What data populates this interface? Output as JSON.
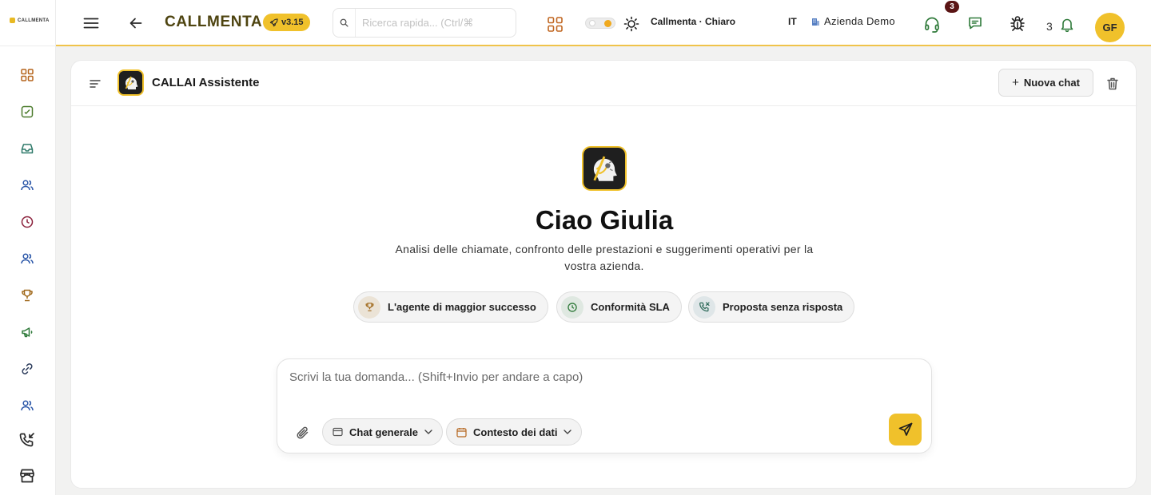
{
  "app": {
    "logo_text": "CALLMENTA",
    "brand": "CALLMENTA",
    "version": "v3.15"
  },
  "sidebar": {
    "items": [
      {
        "name": "dashboard",
        "icon": "grid-icon",
        "color": "#b5651d"
      },
      {
        "name": "reports",
        "icon": "calculator-icon",
        "color": "#4a7a2a"
      },
      {
        "name": "inbox",
        "icon": "inbox-icon",
        "color": "#2f7a6a"
      },
      {
        "name": "users",
        "icon": "users-icon",
        "color": "#2a56a8"
      },
      {
        "name": "history",
        "icon": "clock-icon",
        "color": "#8a1f3a"
      },
      {
        "name": "team",
        "icon": "users-icon",
        "color": "#2a56a8"
      },
      {
        "name": "trophy",
        "icon": "trophy-icon",
        "color": "#a0681a"
      },
      {
        "name": "campaigns",
        "icon": "megaphone-icon",
        "color": "#2f7a3a"
      },
      {
        "name": "integrations",
        "icon": "link-icon",
        "color": "#2a3a5a"
      },
      {
        "name": "agents",
        "icon": "users-icon",
        "color": "#2a56a8"
      },
      {
        "name": "calls",
        "icon": "incoming-call-icon",
        "color": "#2a2a2a"
      },
      {
        "name": "store",
        "icon": "store-icon",
        "color": "#2a2a2a"
      }
    ]
  },
  "header": {
    "search_placeholder": "Ricerca rapida... (Ctrl/⌘",
    "theme_label": "Callmenta · Chiaro",
    "language": "IT",
    "company": "Azienda Demo",
    "support_badge": "3",
    "notification_count": "3",
    "avatar_initials": "GF"
  },
  "assistant": {
    "title": "CALLAI Assistente",
    "new_chat_label": "Nuova chat",
    "greeting": "Ciao Giulia",
    "subtitle": "Analisi delle chiamate, confronto delle prestazioni e suggerimenti operativi per la vostra azienda.",
    "suggestions": [
      {
        "label": "L'agente di maggior successo",
        "icon": "trophy-icon"
      },
      {
        "label": "Conformità SLA",
        "icon": "clock-icon"
      },
      {
        "label": "Proposta senza risposta",
        "icon": "missed-call-icon"
      }
    ],
    "input_placeholder": "Scrivi la tua domanda... (Shift+Invio per andare a capo)",
    "mode_select": "Chat generale",
    "context_select": "Contesto dei dati"
  },
  "colors": {
    "accent": "#f0c12b",
    "brand_text": "#4e4410",
    "badge": "#5a1414"
  }
}
